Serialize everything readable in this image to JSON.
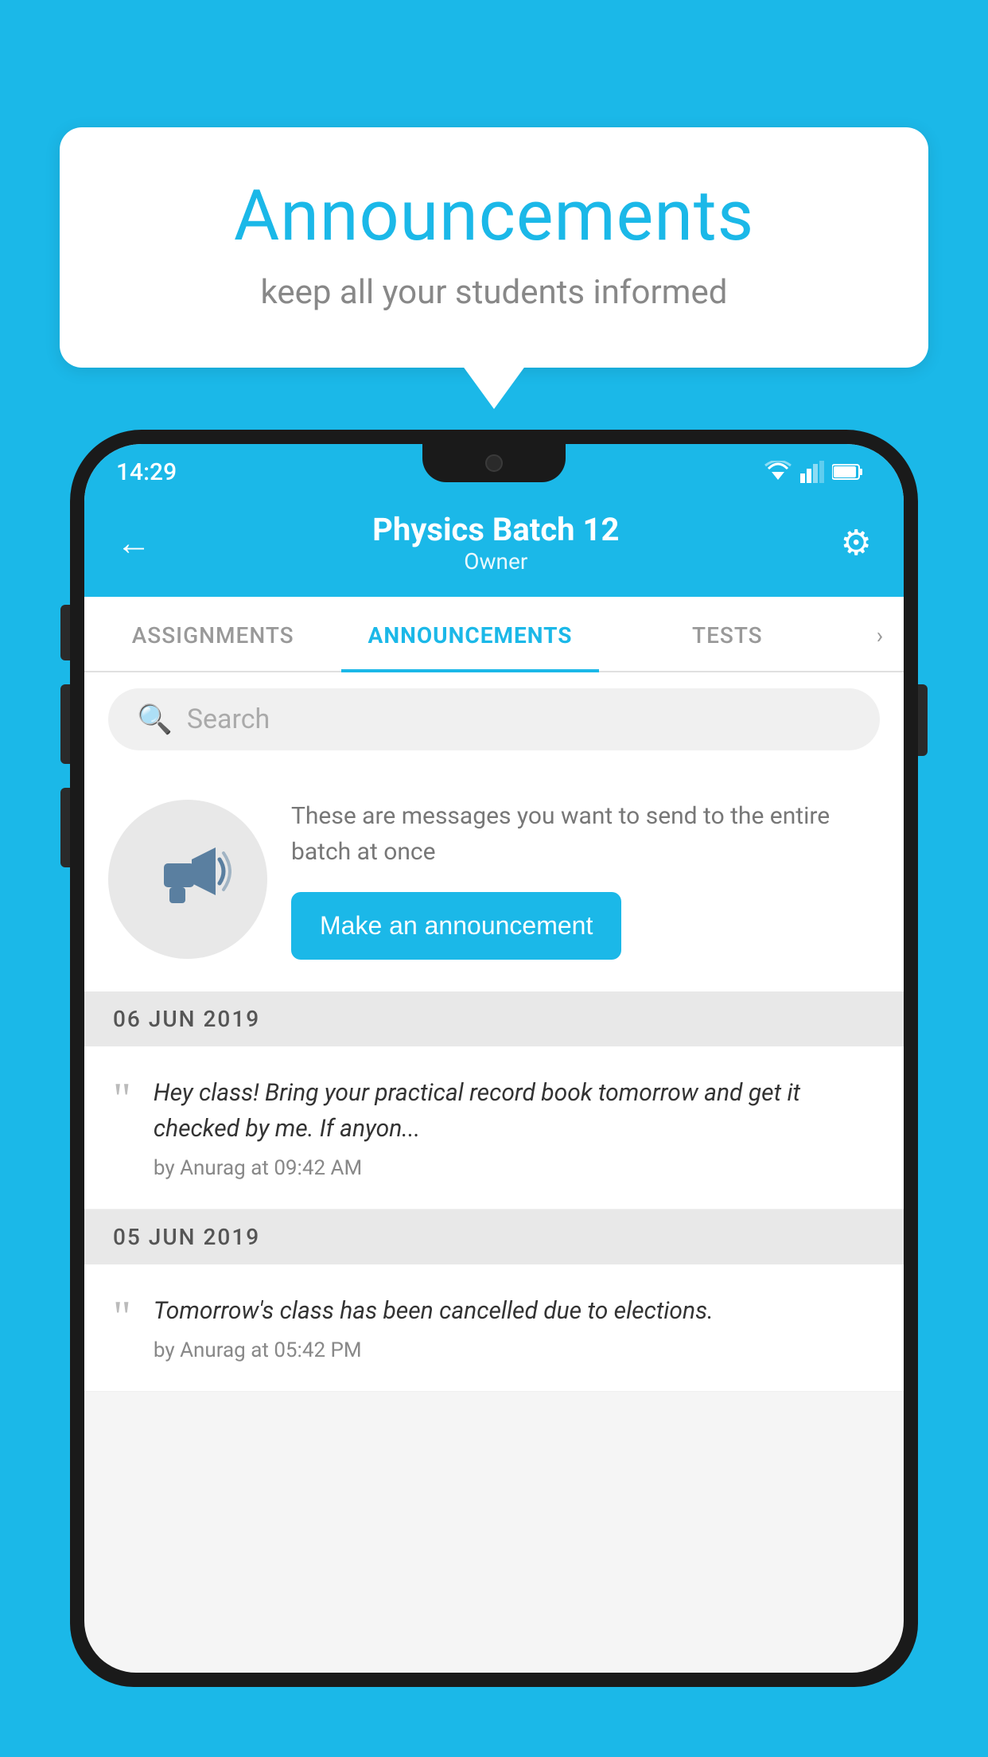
{
  "background_color": "#1BB8E8",
  "speech_bubble": {
    "title": "Announcements",
    "subtitle": "keep all your students informed"
  },
  "phone": {
    "status_bar": {
      "time": "14:29"
    },
    "header": {
      "title": "Physics Batch 12",
      "subtitle": "Owner",
      "back_label": "←",
      "gear_label": "⚙"
    },
    "tabs": [
      {
        "label": "ASSIGNMENTS",
        "active": false
      },
      {
        "label": "ANNOUNCEMENTS",
        "active": true
      },
      {
        "label": "TESTS",
        "active": false
      }
    ],
    "search": {
      "placeholder": "Search"
    },
    "promo": {
      "text": "These are messages you want to send to the entire batch at once",
      "button_label": "Make an announcement"
    },
    "announcements": [
      {
        "date": "06  JUN  2019",
        "message": "Hey class! Bring your practical record book tomorrow and get it checked by me. If anyon...",
        "meta": "by Anurag at 09:42 AM"
      },
      {
        "date": "05  JUN  2019",
        "message": "Tomorrow's class has been cancelled due to elections.",
        "meta": "by Anurag at 05:42 PM"
      }
    ]
  }
}
